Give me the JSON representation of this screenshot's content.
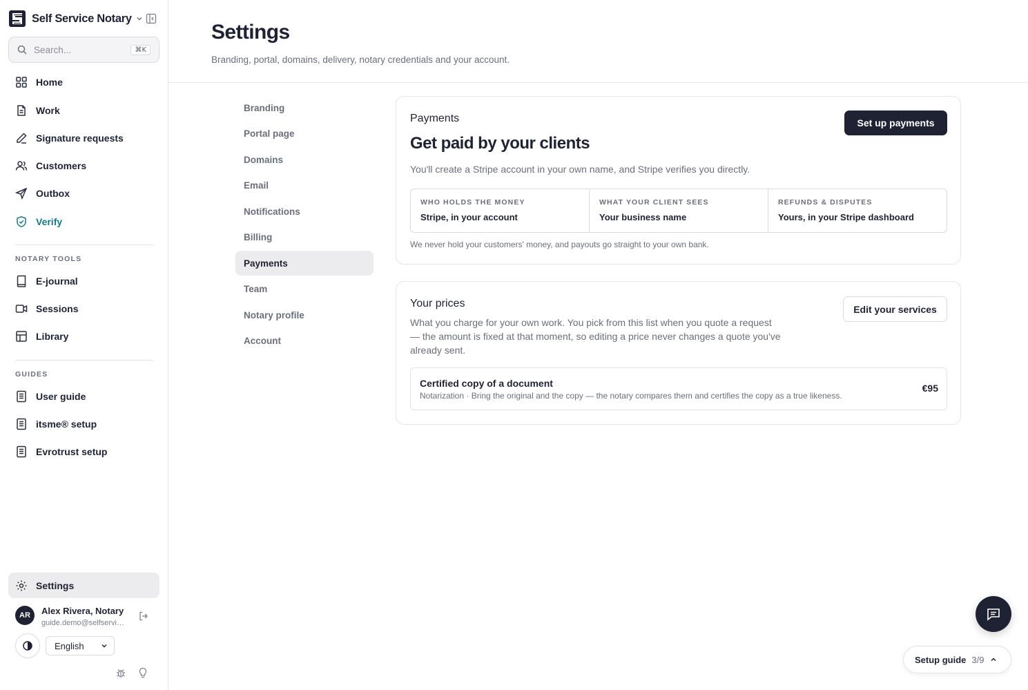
{
  "app": {
    "name": "Self Service Notary"
  },
  "search": {
    "placeholder": "Search...",
    "shortcut": "⌘K"
  },
  "sidebar": {
    "main_items": [
      {
        "label": "Home",
        "icon": "grid-icon"
      },
      {
        "label": "Work",
        "icon": "document-icon"
      },
      {
        "label": "Signature requests",
        "icon": "pen-icon"
      },
      {
        "label": "Customers",
        "icon": "users-icon"
      },
      {
        "label": "Outbox",
        "icon": "send-icon"
      },
      {
        "label": "Verify",
        "icon": "shield-check-icon",
        "color": "#157a85"
      }
    ],
    "notary_tools_label": "NOTARY TOOLS",
    "notary_tools": [
      {
        "label": "E-journal",
        "icon": "book-icon"
      },
      {
        "label": "Sessions",
        "icon": "video-icon"
      },
      {
        "label": "Library",
        "icon": "library-icon"
      }
    ],
    "guides_label": "GUIDES",
    "guides": [
      {
        "label": "User guide",
        "icon": "guide-icon"
      },
      {
        "label": "itsme® setup",
        "icon": "guide-icon"
      },
      {
        "label": "Evrotrust setup",
        "icon": "guide-icon"
      }
    ],
    "settings_label": "Settings",
    "user": {
      "initials": "AR",
      "name": "Alex Rivera, Notary",
      "email": "guide.demo@selfservicenotary.com"
    },
    "language": "English"
  },
  "page": {
    "title": "Settings",
    "subtitle": "Branding, portal, domains, delivery, notary credentials and your account."
  },
  "settings_nav": {
    "items": [
      "Branding",
      "Portal page",
      "Domains",
      "Email",
      "Notifications",
      "Billing",
      "Payments",
      "Team",
      "Notary profile",
      "Account"
    ],
    "active": "Payments"
  },
  "payments_card": {
    "kicker": "Payments",
    "heading": "Get paid by your clients",
    "description": "You'll create a Stripe account in your own name, and Stripe verifies you directly.",
    "button": "Set up payments",
    "facts": [
      {
        "label": "WHO HOLDS THE MONEY",
        "value": "Stripe, in your account"
      },
      {
        "label": "WHAT YOUR CLIENT SEES",
        "value": "Your business name"
      },
      {
        "label": "REFUNDS & DISPUTES",
        "value": "Yours, in your Stripe dashboard"
      }
    ],
    "note": "We never hold your customers' money, and payouts go straight to your own bank."
  },
  "prices_card": {
    "title": "Your prices",
    "description": "What you charge for your own work. You pick from this list when you quote a request — the amount is fixed at that moment, so editing a price never changes a quote you've already sent.",
    "button": "Edit your services",
    "items": [
      {
        "name": "Certified copy of a document",
        "description": "Notarization · Bring the original and the copy — the notary compares them and certifies the copy as a true likeness.",
        "price": "€95"
      }
    ]
  },
  "setup_guide": {
    "label": "Setup guide",
    "progress": "3/9"
  },
  "colors": {
    "primary": "#1f2233",
    "accent": "#157a85",
    "muted": "#6b6f7b",
    "border": "#e5e6ea"
  }
}
